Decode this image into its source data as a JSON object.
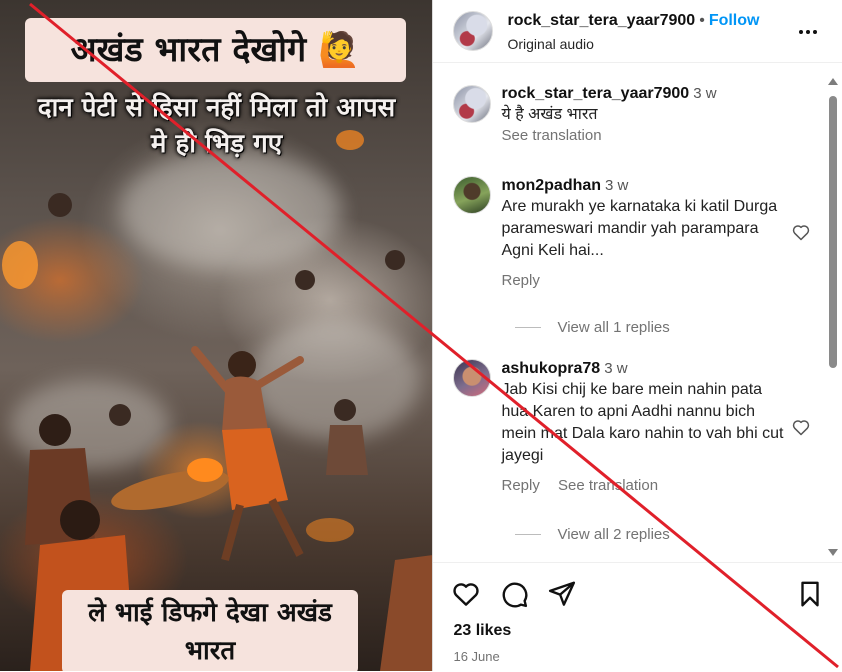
{
  "video": {
    "caption_top": "अखंड भारत देखोगे 🙋",
    "overlay_line1": "दान पेटी से हिसा नहीं मिला तो आपस",
    "overlay_line2": "मे ही भिड़ गए",
    "caption_bottom_line1": "ले भाई डिफगे देखा अखंड",
    "caption_bottom_line2": "भारत"
  },
  "header": {
    "username": "rock_star_tera_yaar7900",
    "separator": "•",
    "follow_label": "Follow",
    "subtitle": "Original audio"
  },
  "caption": {
    "username": "rock_star_tera_yaar7900",
    "age": "3 w",
    "text": "ये है अखंड भारत",
    "see_translation": "See translation"
  },
  "comments": [
    {
      "username": "mon2padhan",
      "age": "3 w",
      "text": "Are murakh ye karnataka ki katil Durga parameswari mandir yah parampara Agni Keli hai...",
      "reply": "Reply",
      "view_all": "View all 1 replies"
    },
    {
      "username": "ashukopra78",
      "age": "3 w",
      "text": "Jab Kisi chij ke bare mein nahin pata hua Karen to apni Aadhi nannu bich mein mat Dala karo nahin to vah bhi cut jayegi",
      "reply": "Reply",
      "see_translation": "See translation",
      "view_all": "View all 2 replies"
    }
  ],
  "footer": {
    "likes": "23 likes",
    "date": "16 June"
  },
  "icons": [
    "more-options-icon",
    "heart-icon",
    "comment-icon",
    "share-icon",
    "bookmark-icon"
  ],
  "colors": {
    "follow": "#0095f6",
    "cross_line": "#e0202a",
    "caption_box": "#f6e3dd"
  }
}
